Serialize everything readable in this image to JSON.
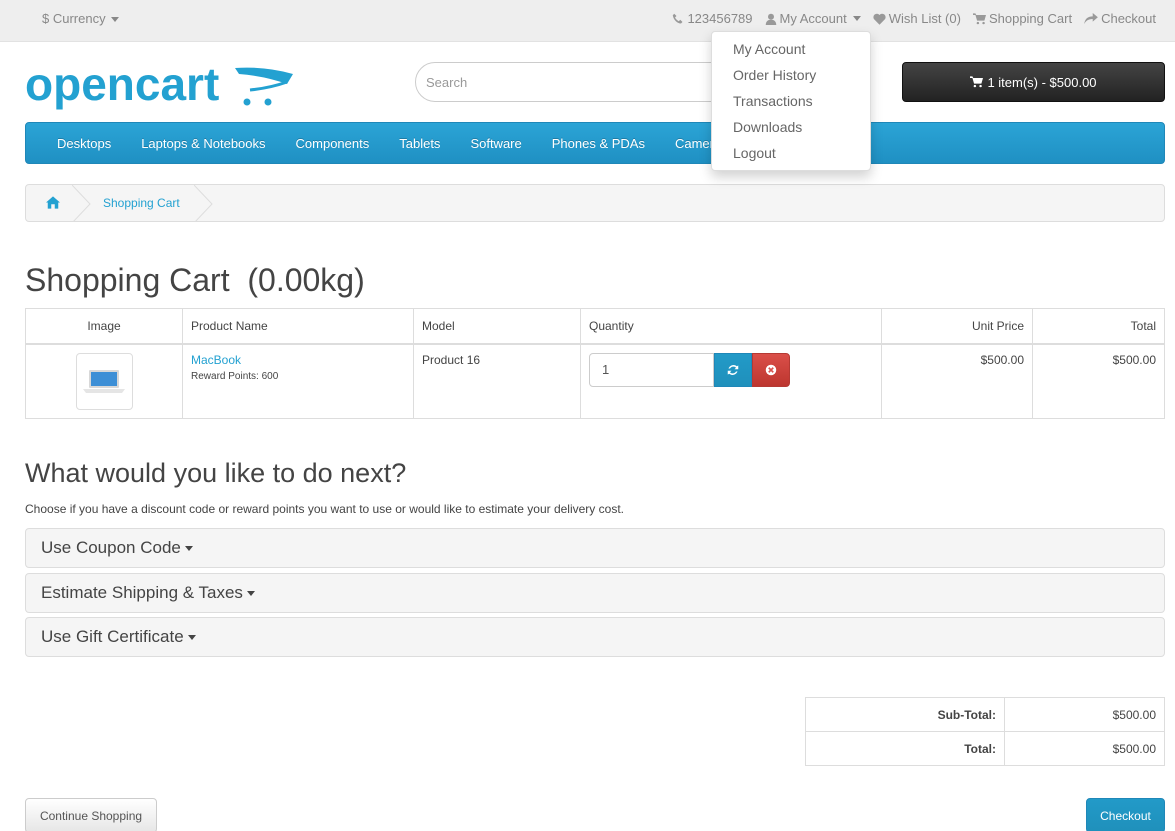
{
  "topbar": {
    "currency_label": "Currency",
    "currency_symbol": "$",
    "phone": "123456789",
    "my_account": "My Account",
    "wish_list": "Wish List (0)",
    "shopping_cart": "Shopping Cart",
    "checkout": "Checkout"
  },
  "account_dropdown": {
    "items": [
      "My Account",
      "Order History",
      "Transactions",
      "Downloads",
      "Logout"
    ]
  },
  "header": {
    "logo_text": "opencart",
    "search_placeholder": "Search",
    "cart_button": "1 item(s) - $500.00"
  },
  "menu": {
    "items": [
      "Desktops",
      "Laptops & Notebooks",
      "Components",
      "Tablets",
      "Software",
      "Phones & PDAs",
      "Cameras"
    ]
  },
  "breadcrumb": {
    "current": "Shopping Cart"
  },
  "page_title": "Shopping Cart  (0.00kg)",
  "cart_table": {
    "headers": [
      "Image",
      "Product Name",
      "Model",
      "Quantity",
      "Unit Price",
      "Total"
    ],
    "rows": [
      {
        "product_name": "MacBook",
        "reward": "Reward Points: 600",
        "model": "Product 16",
        "quantity": "1",
        "unit_price": "$500.00",
        "total": "$500.00"
      }
    ]
  },
  "next_section": {
    "heading": "What would you like to do next?",
    "description": "Choose if you have a discount code or reward points you want to use or would like to estimate your delivery cost.",
    "panels": [
      "Use Coupon Code",
      "Estimate Shipping & Taxes",
      "Use Gift Certificate"
    ]
  },
  "totals": {
    "rows": [
      {
        "label": "Sub-Total:",
        "value": "$500.00"
      },
      {
        "label": "Total:",
        "value": "$500.00"
      }
    ]
  },
  "buttons": {
    "continue": "Continue Shopping",
    "checkout": "Checkout"
  },
  "colors": {
    "accent": "#23a1d1",
    "menu_bg": "#229ac8",
    "danger": "#da4f49",
    "cart_button_bg": "#363636"
  }
}
